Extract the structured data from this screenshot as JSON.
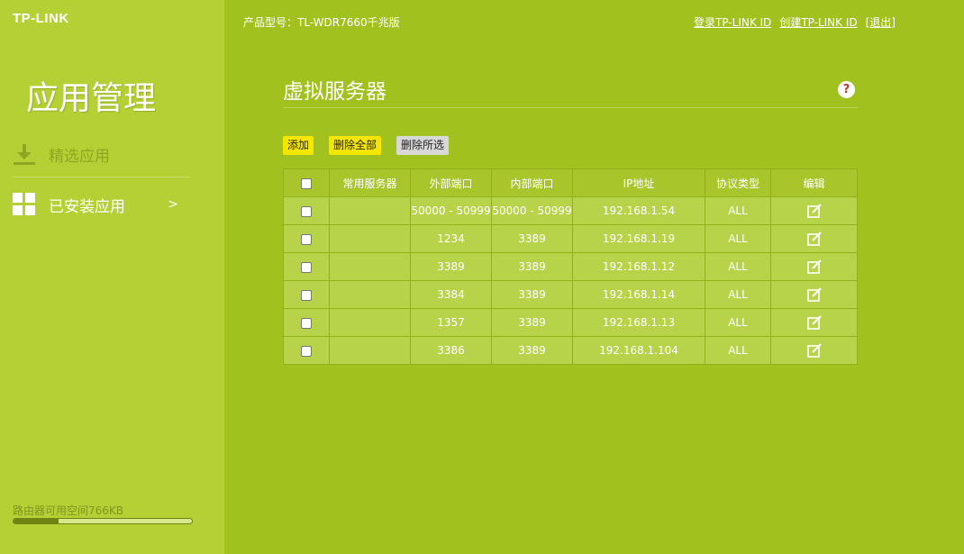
{
  "brand": "TP-LINK",
  "sidebar": {
    "title": "应用管理",
    "items": [
      {
        "label": "精选应用",
        "icon": "download-icon"
      },
      {
        "label": "已安装应用",
        "icon": "grid-icon",
        "arrow": ">"
      }
    ],
    "storage_label": "路由器可用空间766KB",
    "storage_used_fraction": 0.25
  },
  "header": {
    "model": "产品型号：TL-WDR7660千兆版",
    "login_link": "登录TP-LINK ID",
    "create_link": "创建TP-LINK ID",
    "exit_link": "[退出]"
  },
  "page": {
    "title": "虚拟服务器",
    "help": "?"
  },
  "toolbar": {
    "add": "添加",
    "delete_all": "删除全部",
    "delete_selected": "删除所选"
  },
  "table": {
    "headers": [
      "常用服务器",
      "外部端口",
      "内部端口",
      "IP地址",
      "协议类型",
      "编辑"
    ],
    "rows": [
      {
        "common": "",
        "external": "50000 - 50999",
        "internal": "50000 - 50999",
        "ip": "192.168.1.54",
        "protocol": "ALL"
      },
      {
        "common": "",
        "external": "1234",
        "internal": "3389",
        "ip": "192.168.1.19",
        "protocol": "ALL"
      },
      {
        "common": "",
        "external": "3389",
        "internal": "3389",
        "ip": "192.168.1.12",
        "protocol": "ALL"
      },
      {
        "common": "",
        "external": "3384",
        "internal": "3389",
        "ip": "192.168.1.14",
        "protocol": "ALL"
      },
      {
        "common": "",
        "external": "1357",
        "internal": "3389",
        "ip": "192.168.1.13",
        "protocol": "ALL"
      },
      {
        "common": "",
        "external": "3386",
        "internal": "3389",
        "ip": "192.168.1.104",
        "protocol": "ALL"
      }
    ]
  },
  "colors": {
    "main_bg": "#a1c11f",
    "sidebar_bg": "#b4d034",
    "button_yellow": "#f5e600",
    "button_gray": "#d8d8d8",
    "help_red": "#c0392b"
  }
}
